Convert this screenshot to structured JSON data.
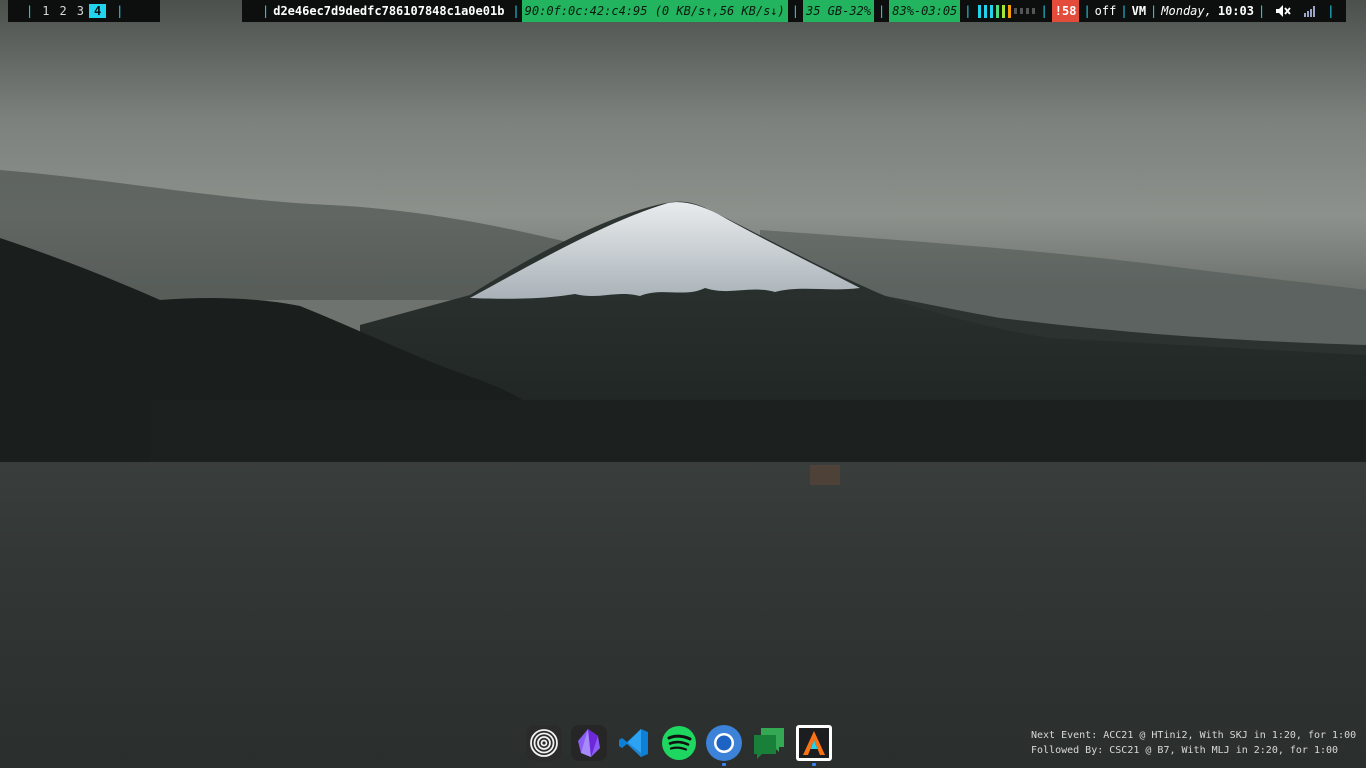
{
  "topbar": {
    "separator": "|",
    "workspaces": [
      {
        "label": "1",
        "active": false
      },
      {
        "label": "2",
        "active": false
      },
      {
        "label": "3",
        "active": false
      },
      {
        "label": "4",
        "active": true
      }
    ],
    "window_title": "d2e46ec7d9dedfc786107848c1a0e01b",
    "network": "90:0f:0c:42:c4:95 (0 KB/s↑,56 KB/s↓)",
    "disk": "35 GB-32%",
    "battery": "83%-03:05",
    "cpu_bars": {
      "levels": [
        0.9,
        0.9,
        0.9,
        0.9,
        0.9,
        0.9,
        0.2,
        0.2,
        0.2,
        0.2
      ],
      "colors": [
        "#22d3ee",
        "#22d3ee",
        "#22d3ee",
        "#4ade80",
        "#a3e635",
        "#f59e0b",
        "#555555",
        "#555555",
        "#555555",
        "#555555"
      ]
    },
    "alert": "!58",
    "toggle": "off",
    "vm": "VM",
    "day": "Monday,",
    "time": "10:03",
    "volume_icon": "speaker-muted-icon",
    "signal_icon": "signal-bars-icon",
    "accent": "#22d3ee"
  },
  "dock": {
    "apps": [
      {
        "name": "concentric-rings-app-icon"
      },
      {
        "name": "obsidian-icon"
      },
      {
        "name": "vscode-icon"
      },
      {
        "name": "spotify-icon"
      },
      {
        "name": "chromium-icon"
      },
      {
        "name": "chat-icon"
      },
      {
        "name": "alacritty-icon"
      }
    ]
  },
  "events": {
    "next": "Next Event: ACC21 @ HTini2, With SKJ in 1:20, for 1:00",
    "followed": "Followed By: CSC21 @ B7, With MLJ in 2:20, for 1:00"
  }
}
